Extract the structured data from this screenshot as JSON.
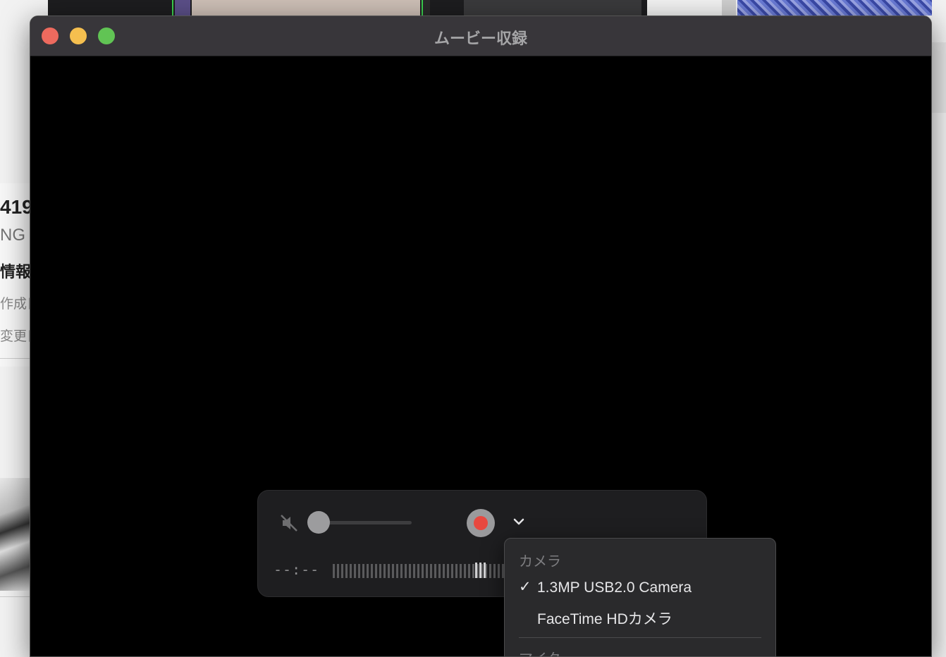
{
  "window": {
    "title": "ムービー収録"
  },
  "background": {
    "text1": "419",
    "text2": "NG",
    "text3": "情報",
    "text4": "作成日",
    "text5": "変更日"
  },
  "controls": {
    "time": "--:--",
    "volume_fraction": 0.0
  },
  "menu": {
    "camera_header": "カメラ",
    "items": [
      {
        "label": "1.3MP USB2.0 Camera",
        "checked": "✓"
      },
      {
        "label": "FaceTime HDカメラ",
        "checked": ""
      }
    ],
    "mic_header": "マイク"
  },
  "colors": {
    "record": "#e8483f",
    "titlebar": "#38363a"
  }
}
